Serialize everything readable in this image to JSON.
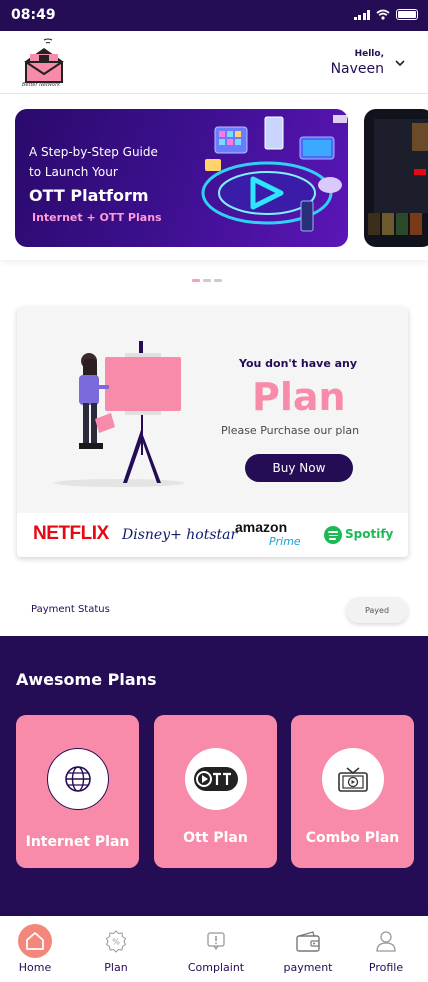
{
  "status_bar": {
    "time": "08:49"
  },
  "header": {
    "logo_caption": "Better Network",
    "greeting": "Hello,",
    "user_name": "Naveen"
  },
  "banner": {
    "line1": "A Step-by-Step Guide",
    "line2": "to Launch Your",
    "title": "OTT Platform",
    "subtitle": "Internet + OTT Plans",
    "slide_count": 3,
    "active_slide": 1
  },
  "plan_card": {
    "heading": "You don't have any",
    "big_word": "Plan",
    "message": "Please Purchase our plan",
    "buy_button": "Buy Now",
    "partners": {
      "netflix": "NETFLIX",
      "disney": "Disney+ hotstar",
      "amazon": "amazon",
      "prime": "Prime",
      "spotify": "Spotify"
    }
  },
  "payment_status": {
    "label": "Payment Status",
    "value": "Payed"
  },
  "plans_section": {
    "title": "Awesome Plans",
    "tiles": [
      {
        "label": "Internet Plan",
        "icon": "globe-icon"
      },
      {
        "label": "Ott Plan",
        "icon": "ott-icon"
      },
      {
        "label": "Combo Plan",
        "icon": "tv-play-icon"
      }
    ]
  },
  "bottom_nav": {
    "items": [
      {
        "label": "Home",
        "icon": "home-icon",
        "active": true
      },
      {
        "label": "Plan",
        "icon": "percent-badge-icon"
      },
      {
        "label": "Complaint",
        "icon": "complaint-icon"
      },
      {
        "label": "payment",
        "icon": "wallet-icon"
      },
      {
        "label": "Profile",
        "icon": "user-icon"
      }
    ]
  },
  "colors": {
    "primary": "#250d55",
    "accent_pink": "#f78ba9",
    "home_active": "#f4877c"
  }
}
